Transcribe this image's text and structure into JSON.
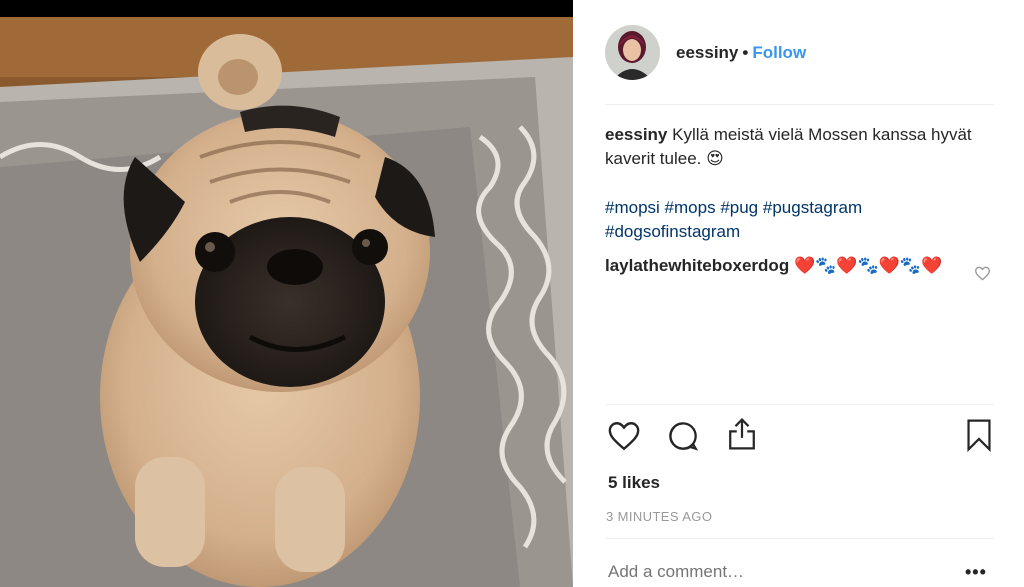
{
  "post": {
    "username": "eessiny",
    "separator": "•",
    "follow_label": "Follow",
    "caption_text": "Kyllä meistä vielä Mossen kanssa hyvät kaverit tulee. 😍",
    "hashtags": [
      "#mopsi",
      "#mops",
      "#pug",
      "#pugstagram",
      "#dogsofinstagram"
    ]
  },
  "comments": [
    {
      "username": "laylathewhiteboxerdog",
      "text": "❤️🐾❤️🐾❤️🐾❤️"
    }
  ],
  "stats": {
    "likes": "5 likes",
    "time": "3 MINUTES AGO"
  },
  "add_comment": {
    "placeholder": "Add a comment…",
    "more": "•••"
  },
  "icons": {
    "like": "heart-icon",
    "comment": "comment-icon",
    "share": "share-icon",
    "save": "bookmark-icon",
    "comment_like": "small-heart-icon"
  },
  "colors": {
    "follow": "#3897f0",
    "hashtag": "#003569",
    "muted": "#999999"
  }
}
